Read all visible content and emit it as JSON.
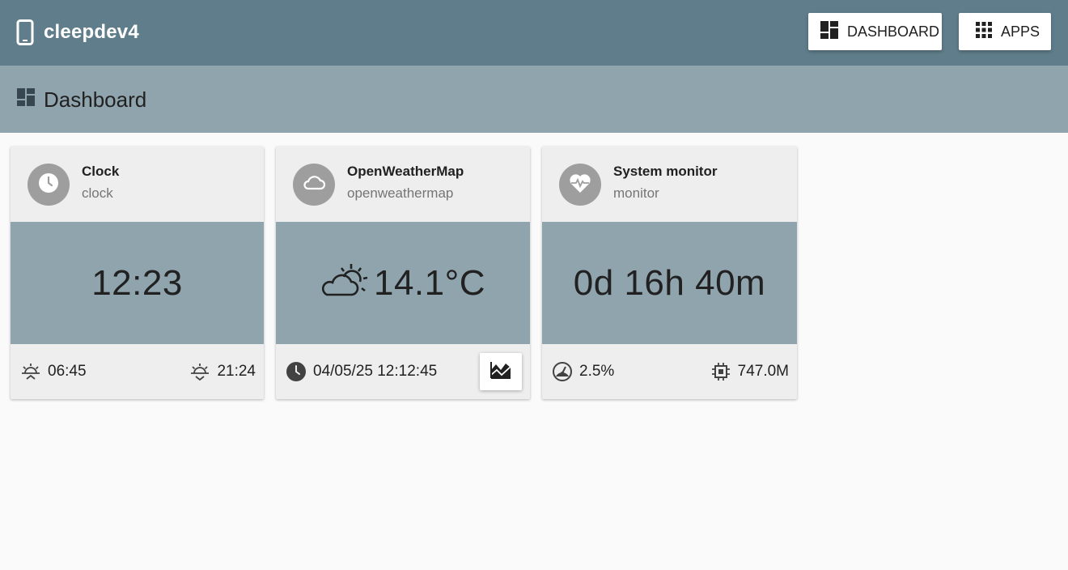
{
  "app": {
    "name": "cleepdev4"
  },
  "nav": {
    "dashboard_label": "DASHBOARD",
    "apps_label": "APPS"
  },
  "page": {
    "title": "Dashboard"
  },
  "colors": {
    "topbar": "#607d8b",
    "subbar": "#90a4ae",
    "card_body": "#90a4ae",
    "card": "#eeeeee",
    "avatar": "#9e9e9e"
  },
  "cards": [
    {
      "title": "Clock",
      "subtitle": "clock",
      "icon": "clock-icon",
      "value": "12:23",
      "footer_left": "06:45",
      "footer_left_icon": "sunrise-icon",
      "footer_right": "21:24",
      "footer_right_icon": "sunset-icon"
    },
    {
      "title": "OpenWeatherMap",
      "subtitle": "openweathermap",
      "icon": "cloud-icon",
      "value_icon": "partly-cloudy-icon",
      "value": "14.1°C",
      "footer_left": "04/05/25 12:12:45",
      "footer_left_icon": "clock-icon",
      "footer_right_icon": "chart-icon"
    },
    {
      "title": "System monitor",
      "subtitle": "monitor",
      "icon": "heart-pulse-icon",
      "value": "0d 16h 40m",
      "footer_left": "2.5%",
      "footer_left_icon": "speedometer-icon",
      "footer_right": "747.0M",
      "footer_right_icon": "chip-icon"
    }
  ]
}
